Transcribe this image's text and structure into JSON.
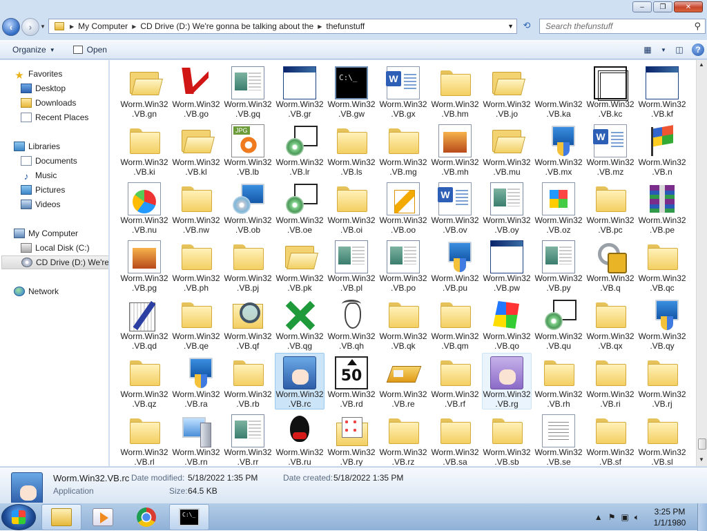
{
  "window": {
    "controls": [
      "–",
      "❐",
      "✕"
    ]
  },
  "address": {
    "segments": [
      "My Computer",
      "CD Drive (D:) We're gonna be talking about the",
      "thefunstuff"
    ]
  },
  "search": {
    "placeholder": "Search thefunstuff"
  },
  "toolbar": {
    "organize": "Organize",
    "open": "Open"
  },
  "nav": {
    "favorites": "Favorites",
    "desktop": "Desktop",
    "downloads": "Downloads",
    "recent_places": "Recent Places",
    "libraries": "Libraries",
    "documents": "Documents",
    "music": "Music",
    "pictures": "Pictures",
    "videos": "Videos",
    "my_computer": "My Computer",
    "local_disk": "Local Disk (C:)",
    "cd_drive": "CD Drive (D:) We're g",
    "network": "Network"
  },
  "files": [
    {
      "name": "Worm.Win32.VB.gn",
      "icon": "openfolder"
    },
    {
      "name": "Worm.Win32.VB.go",
      "icon": "kas"
    },
    {
      "name": "Worm.Win32.VB.gq",
      "icon": "app"
    },
    {
      "name": "Worm.Win32.VB.gr",
      "icon": "window"
    },
    {
      "name": "Worm.Win32.VB.gw",
      "icon": "cmd"
    },
    {
      "name": "Worm.Win32.VB.gx",
      "icon": "doc"
    },
    {
      "name": "Worm.Win32.VB.hm",
      "icon": "folder"
    },
    {
      "name": "Worm.Win32.VB.jo",
      "icon": "openfolder"
    },
    {
      "name": "Worm.Win32.VB.ka",
      "icon": "none"
    },
    {
      "name": "Worm.Win32.VB.kc",
      "icon": "maze"
    },
    {
      "name": "Worm.Win32.VB.kf",
      "icon": "window"
    },
    {
      "name": "Worm.Win32.VB.ki",
      "icon": "folder"
    },
    {
      "name": "Worm.Win32.VB.kl",
      "icon": "openfolder"
    },
    {
      "name": "Worm.Win32.VB.lb",
      "icon": "jpg"
    },
    {
      "name": "Worm.Win32.VB.lr",
      "icon": "setupcd"
    },
    {
      "name": "Worm.Win32.VB.ls",
      "icon": "folder"
    },
    {
      "name": "Worm.Win32.VB.mg",
      "icon": "folder"
    },
    {
      "name": "Worm.Win32.VB.mh",
      "icon": "img"
    },
    {
      "name": "Worm.Win32.VB.mu",
      "icon": "openfolder"
    },
    {
      "name": "Worm.Win32.VB.mx",
      "icon": "setupshield"
    },
    {
      "name": "Worm.Win32.VB.mz",
      "icon": "doc"
    },
    {
      "name": "Worm.Win32.VB.n",
      "icon": "flag"
    },
    {
      "name": "Worm.Win32.VB.nu",
      "icon": "chart"
    },
    {
      "name": "Worm.Win32.VB.nw",
      "icon": "folder"
    },
    {
      "name": "Worm.Win32.VB.ob",
      "icon": "setup"
    },
    {
      "name": "Worm.Win32.VB.oe",
      "icon": "setupcd"
    },
    {
      "name": "Worm.Win32.VB.oi",
      "icon": "folder"
    },
    {
      "name": "Worm.Win32.VB.oo",
      "icon": "notes"
    },
    {
      "name": "Worm.Win32.VB.ov",
      "icon": "doc"
    },
    {
      "name": "Worm.Win32.VB.oy",
      "icon": "app"
    },
    {
      "name": "Worm.Win32.VB.oz",
      "icon": "winlogo"
    },
    {
      "name": "Worm.Win32.VB.pc",
      "icon": "folder"
    },
    {
      "name": "Worm.Win32.VB.pe",
      "icon": "rar"
    },
    {
      "name": "Worm.Win32.VB.pg",
      "icon": "img"
    },
    {
      "name": "Worm.Win32.VB.ph",
      "icon": "folder"
    },
    {
      "name": "Worm.Win32.VB.pj",
      "icon": "folder"
    },
    {
      "name": "Worm.Win32.VB.pk",
      "icon": "openfolder"
    },
    {
      "name": "Worm.Win32.VB.pl",
      "icon": "app"
    },
    {
      "name": "Worm.Win32.VB.po",
      "icon": "app"
    },
    {
      "name": "Worm.Win32.VB.pu",
      "icon": "setupshield"
    },
    {
      "name": "Worm.Win32.VB.pw",
      "icon": "window"
    },
    {
      "name": "Worm.Win32.VB.py",
      "icon": "app"
    },
    {
      "name": "Worm.Win32.VB.q",
      "icon": "keys"
    },
    {
      "name": "Worm.Win32.VB.qc",
      "icon": "folder"
    },
    {
      "name": "Worm.Win32.VB.qd",
      "icon": "pen"
    },
    {
      "name": "Worm.Win32.VB.qe",
      "icon": "folder"
    },
    {
      "name": "Worm.Win32.VB.qf",
      "icon": "search"
    },
    {
      "name": "Worm.Win32.VB.qg",
      "icon": "xmark"
    },
    {
      "name": "Worm.Win32.VB.qh",
      "icon": "goat"
    },
    {
      "name": "Worm.Win32.VB.qk",
      "icon": "folder"
    },
    {
      "name": "Worm.Win32.VB.qm",
      "icon": "folder"
    },
    {
      "name": "Worm.Win32.VB.qo",
      "icon": "msn"
    },
    {
      "name": "Worm.Win32.VB.qu",
      "icon": "setupcd"
    },
    {
      "name": "Worm.Win32.VB.qx",
      "icon": "folder"
    },
    {
      "name": "Worm.Win32.VB.qy",
      "icon": "setupshield"
    },
    {
      "name": "Worm.Win32.VB.qz",
      "icon": "folder"
    },
    {
      "name": "Worm.Win32.VB.ra",
      "icon": "setupshield"
    },
    {
      "name": "Worm.Win32.VB.rb",
      "icon": "folder"
    },
    {
      "name": "Worm.Win32.VB.rc",
      "icon": "anime",
      "selected": true
    },
    {
      "name": "Worm.Win32.VB.rd",
      "icon": "fifty"
    },
    {
      "name": "Worm.Win32.VB.re",
      "icon": "book"
    },
    {
      "name": "Worm.Win32.VB.rf",
      "icon": "folder"
    },
    {
      "name": "Worm.Win32.VB.rg",
      "icon": "anime2",
      "hover": true
    },
    {
      "name": "Worm.Win32.VB.rh",
      "icon": "folder"
    },
    {
      "name": "Worm.Win32.VB.ri",
      "icon": "folder"
    },
    {
      "name": "Worm.Win32.VB.rj",
      "icon": "folder"
    },
    {
      "name": "Worm.Win32.VB.rl",
      "icon": "folder"
    },
    {
      "name": "Worm.Win32.VB.rn",
      "icon": "pc"
    },
    {
      "name": "Worm.Win32.VB.rr",
      "icon": "app"
    },
    {
      "name": "Worm.Win32.VB.ru",
      "icon": "penguin"
    },
    {
      "name": "Worm.Win32.VB.ry",
      "icon": "cpanel"
    },
    {
      "name": "Worm.Win32.VB.rz",
      "icon": "folder"
    },
    {
      "name": "Worm.Win32.VB.sa",
      "icon": "folder"
    },
    {
      "name": "Worm.Win32.VB.sb",
      "icon": "folder"
    },
    {
      "name": "Worm.Win32.VB.se",
      "icon": "text"
    },
    {
      "name": "Worm.Win32.VB.sf",
      "icon": "folder"
    },
    {
      "name": "Worm.Win32.VB.sl",
      "icon": "folder"
    }
  ],
  "details": {
    "name": "Worm.Win32.VB.rc",
    "type": "Application",
    "modified_label": "Date modified:",
    "modified_value": "5/18/2022 1:35 PM",
    "created_label": "Date created:",
    "created_value": "5/18/2022 1:35 PM",
    "size_label": "Size:",
    "size_value": "64.5 KB"
  },
  "taskbar": {
    "clock_time": "3:25 PM",
    "clock_date": "1/1/1980",
    "cmd_icon_text": "C:\\_"
  },
  "colors": {
    "selection": "#cce4f7",
    "taskbar": "#9dbbe0",
    "accent": "#2d62b0"
  }
}
